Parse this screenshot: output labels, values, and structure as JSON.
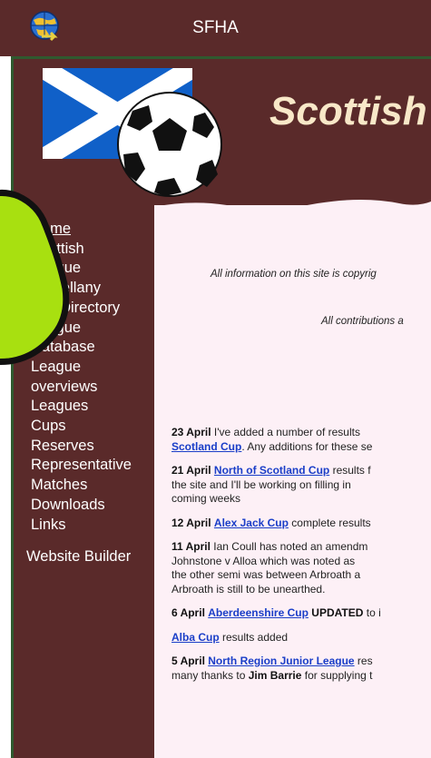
{
  "appbar": {
    "title": "SFHA",
    "icon": "globe-icon"
  },
  "site": {
    "title": "Scottish"
  },
  "nav": {
    "items": [
      "Home",
      "Scottish",
      "League",
      "Miscellany",
      "Info Directory",
      "League",
      "Database",
      "League",
      "overviews",
      "Leagues",
      "Cups",
      "Reserves",
      "Representative",
      "Matches",
      "Downloads",
      "Links"
    ],
    "builder": "Website Builder"
  },
  "notices": {
    "copyright": "All information on this site is copyrig",
    "contributions": "All contributions a"
  },
  "news": [
    {
      "date": "23 April",
      "line1": " I've added a number of results",
      "link": "Scotland Cup",
      "line2": ". Any additions for these se"
    },
    {
      "date": "21 April",
      "link": "North of Scotland Cup",
      "line1": " results f",
      "line2": "the site and I'll be working on filling in",
      "line3": "coming weeks"
    },
    {
      "date": "12 April",
      "link": "Alex Jack Cup",
      "line1": " complete results "
    },
    {
      "date": "11 April",
      "line1": " Ian Coull has noted an amendm",
      "line2": "Johnstone v Alloa which was noted as",
      "line3": "the other semi was between Arbroath a",
      "line4": "Arbroath is still to be unearthed."
    },
    {
      "date": "6 April",
      "link": "Aberdeenshire Cup",
      "strong": " UPDATED",
      "line1": " to i"
    },
    {
      "link": "Alba Cup",
      "line1": " results added"
    },
    {
      "date": "5 April",
      "link": "North Region Junior League",
      "line1": " res",
      "line2": "many thanks to ",
      "strong": "Jim Barrie",
      "line3": " for supplying t"
    }
  ],
  "colors": {
    "maroon": "#5a2a2a",
    "panel": "#fdf0f6",
    "link": "#1a3ec8",
    "annotation": "#a8e010"
  }
}
